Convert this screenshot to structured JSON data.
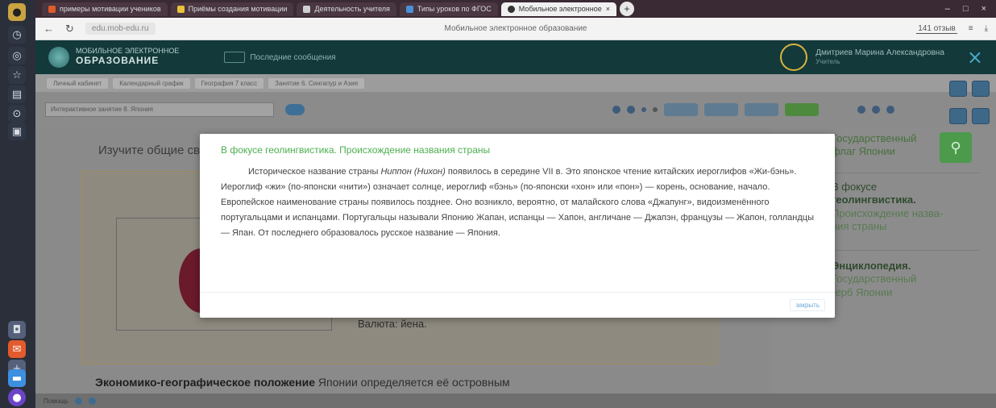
{
  "browser": {
    "tabs": [
      {
        "label": "примеры мотивации учеников",
        "color": "#e05a2c"
      },
      {
        "label": "Приёмы создания мотивации",
        "color": "#e8c23a"
      },
      {
        "label": "Деятельность учителя",
        "color": "#cfcfcf"
      },
      {
        "label": "Типы уроков по ФГОС",
        "color": "#4a90d9"
      },
      {
        "label": "Мобильное электронное",
        "color": "#333333"
      }
    ],
    "new_tab_label": "+",
    "window_controls": [
      "–",
      "□",
      "×"
    ],
    "url": "edu.mob-edu.ru",
    "page_title": "Мобильное электронное образование",
    "reviews_label": "141 отзыв",
    "nav_back": "←",
    "nav_reload": "↻"
  },
  "app_header": {
    "logo_small": "МОБИЛЬНОЕ ЭЛЕКТРОННОЕ",
    "logo_big": "ОБРАЗОВАНИЕ",
    "last_messages": "Последние сообщения",
    "user_name": "Дмитриев Марина Александровна",
    "user_role": "Учитель",
    "close_icon": "×"
  },
  "crumbs": [
    "Личный кабинет",
    "Календарный график",
    "География 7 класс",
    "Занятие 6. Сингапур и Азия"
  ],
  "toolbar": {
    "lesson_select_value": "Интерактивное занятие 8. Япония"
  },
  "content": {
    "heading": "Изучите общие сведения",
    "currency": "Валюта: йена.",
    "paragraph_bold": "Экономико-географическое положение",
    "paragraph_rest": " Японии определяется её островным"
  },
  "right_panel": {
    "item1": [
      "Государственный",
      "флаг Японии"
    ],
    "item2_title": [
      "В фокусе",
      "геолингвистика."
    ],
    "item2_sub": [
      "Происхождение назва-",
      "ния страны"
    ],
    "item3_title": "Энциклопедия.",
    "item3_sub": [
      "Государственный",
      "герб Японии"
    ],
    "search_icon": "search-icon"
  },
  "statusbar": {
    "label": "Помощь"
  },
  "modal": {
    "title": "В фокусе геолингвистика. Происхождение названия страны",
    "body_part1": "Историческое название страны ",
    "body_italic": "Ниппон (Нихон)",
    "body_part2": " появилось в середине VII в. Это японское чтение китайских иероглифов «Жи-бэнь». Иероглиф «жи» (по-японски «нити») означает солнце, иероглиф «бэнь» (по-японски «хон» или «пон») — корень, основание, начало. Европейское наименование страны появилось позднее. Оно возникло, вероятно, от малайского слова «Джапунг», видоизменённого португальцами и испанцами. Португальцы называли Японию Жапан, испанцы — Хапон, англичане — Джапэн, французы — Жапон, голландцы — Япан. От последнего образовалось русское название — Япония.",
    "close_label": "закрыть"
  }
}
